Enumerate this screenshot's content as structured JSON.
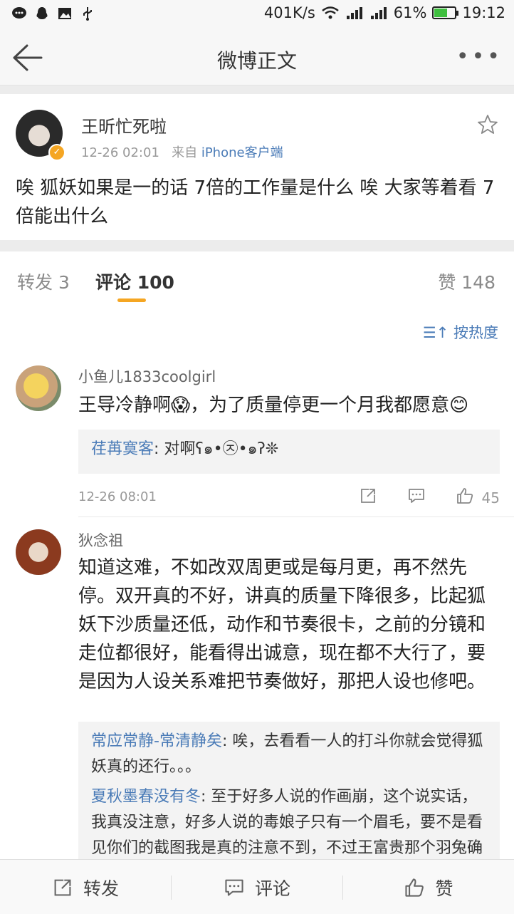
{
  "status_bar": {
    "network_speed": "401K/s",
    "battery_percent": "61%",
    "battery_level": 0.61,
    "time": "19:12",
    "left_icons": [
      "chat-icon",
      "qq-icon",
      "image-icon",
      "usb-icon"
    ]
  },
  "nav": {
    "title": "微博正文"
  },
  "post": {
    "author": "王昕忙死啦",
    "time": "12-26 02:01",
    "source_prefix": "来自",
    "source": "iPhone客户端",
    "content": "唉 狐妖如果是一的话 7倍的工作量是什么 唉 大家等着看 7倍能出什么"
  },
  "tabs": {
    "repost": "转发 3",
    "comments": "评论 100",
    "likes": "赞 148"
  },
  "sort_label": "按热度",
  "comments": [
    {
      "user": "小鱼儿1833coolgirl",
      "text": "王导冷静啊😱，为了质量停更一个月我都愿意😊",
      "replies": [
        {
          "user": "荏苒寞客",
          "text": "对啊ʕ๑•㉨•๑ʔ❊"
        }
      ],
      "time": "12-26 08:01",
      "likes": "45"
    },
    {
      "user": "狄念祖",
      "text": "知道这难，不如改双周更或是每月更，再不然先停。双开真的不好，讲真的质量下降很多，比起狐妖下沙质量还低，动作和节奏很卡，之前的分镜和走位都很好，能看得出诚意，现在都不大行了，要是因为人设关系难把节奏做好，那把人设也修吧。",
      "replies": [
        {
          "user": "常应常静-常清静矣",
          "text": "唉，去看看一人的打斗你就会觉得狐妖真的还行。。。"
        },
        {
          "user": "夏秋墨春没有冬",
          "text": "至于好多人说的作画崩，这个说实话，我真没注意，好多人说的毒娘子只有一个眉毛，要不是看见你们的截图我是真的注意不到，不过王富贵那个羽兔确实不好，制作的时候就不能画个好看点"
        }
      ]
    }
  ],
  "bottom_bar": {
    "repost": "转发",
    "comment": "评论",
    "like": "赞"
  },
  "colors": {
    "link": "#4a7bb7",
    "accent": "#f5a623"
  }
}
